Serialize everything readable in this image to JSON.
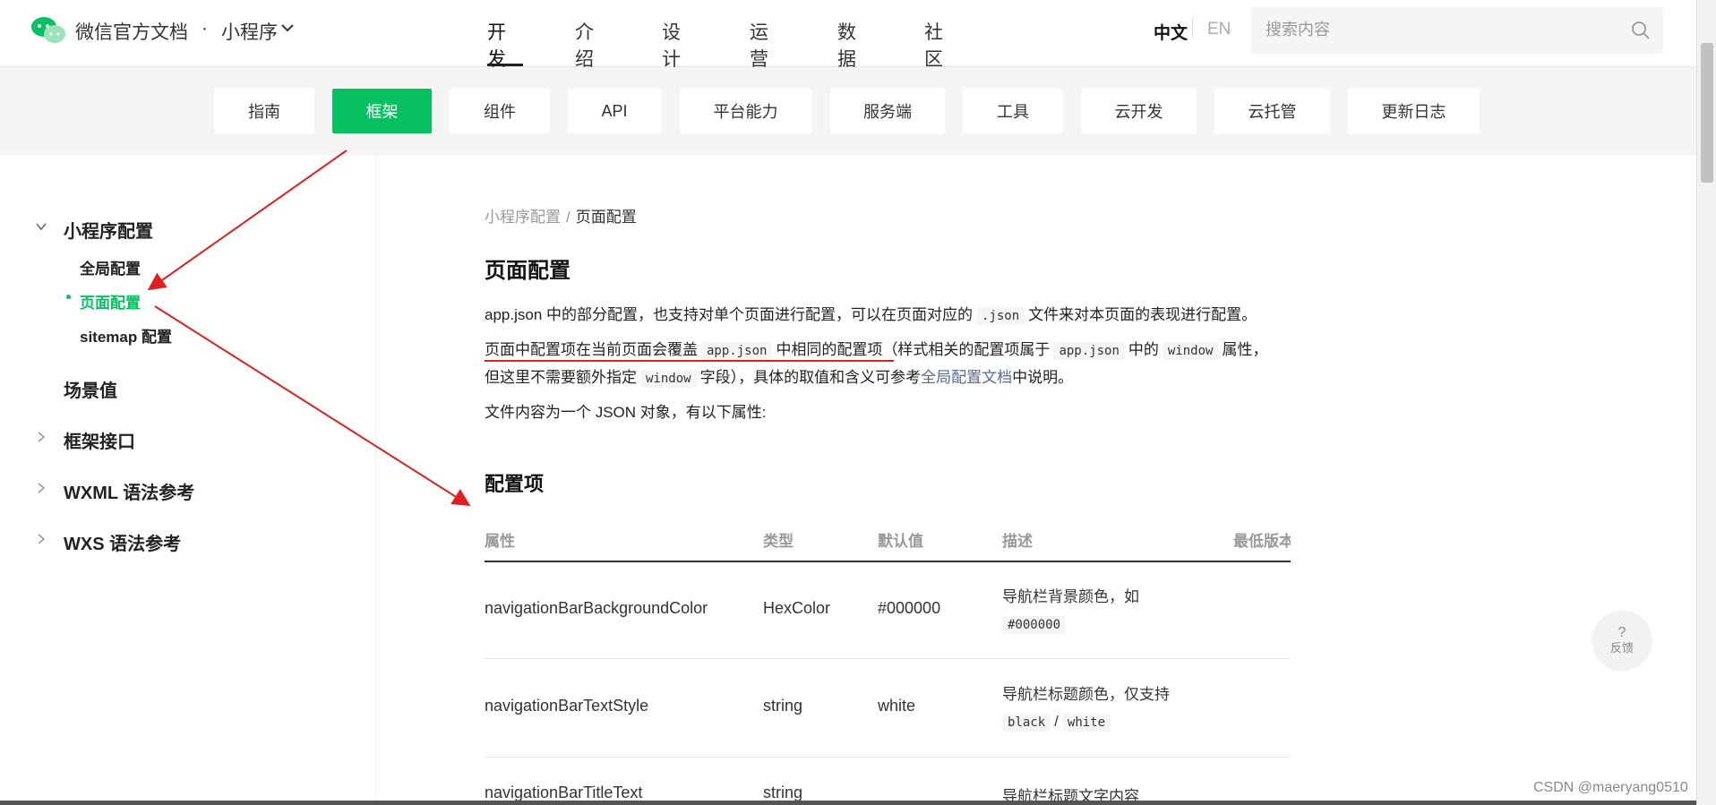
{
  "header": {
    "brand": "微信官方文档",
    "brand_separator": "·",
    "brand_sub": "小程序",
    "nav": [
      "开发",
      "介绍",
      "设计",
      "运营",
      "数据",
      "社区"
    ],
    "active_nav": "开发",
    "lang_zh": "中文",
    "lang_en": "EN",
    "search_placeholder": "搜索内容"
  },
  "subnav": {
    "items": [
      "指南",
      "框架",
      "组件",
      "API",
      "平台能力",
      "服务端",
      "工具",
      "云开发",
      "云托管",
      "更新日志"
    ],
    "active": "框架"
  },
  "sidebar": {
    "section": "小程序配置",
    "section_items": [
      "全局配置",
      "页面配置",
      "sitemap 配置"
    ],
    "active_item": "页面配置",
    "others": [
      "场景值",
      "框架接口",
      "WXML 语法参考",
      "WXS 语法参考"
    ]
  },
  "content": {
    "breadcrumb_parent": "小程序配置",
    "breadcrumb_sep": "/",
    "breadcrumb_current": "页面配置",
    "title": "页面配置",
    "p1_a": "app.json 中的部分配置，也支持对单个页面进行配置，可以在页面对应的",
    "p1_code": ".json",
    "p1_b": "文件来对本页面的表现进行配置。",
    "p2_a": "页面中配置项在当前页面会覆盖",
    "p2_code1": "app.json",
    "p2_b": "中相同的配置项",
    "p2_c": "（样式相关的配置项属于",
    "p2_code2": "app.json",
    "p2_d": "中的",
    "p2_code3": "window",
    "p2_e": "属性，",
    "p3_a": "但这里不需要额外指定",
    "p3_code": "window",
    "p3_b": "字段），具体的取值和含义可参考",
    "p3_link": "全局配置文档",
    "p3_c": "中说明。",
    "p4": "文件内容为一个 JSON 对象，有以下属性:",
    "section_title": "配置项"
  },
  "table": {
    "headers": [
      "属性",
      "类型",
      "默认值",
      "描述",
      "最低版本"
    ],
    "rows": [
      {
        "property": "navigationBarBackgroundColor",
        "type": "HexColor",
        "default": "#000000",
        "desc_text": "导航栏背景颜色，如",
        "desc_code": "#000000"
      },
      {
        "property": "navigationBarTextStyle",
        "type": "string",
        "default": "white",
        "desc_text": "导航栏标题颜色，仅支持",
        "desc_code1": "black",
        "desc_sep": "/",
        "desc_code2": "white"
      },
      {
        "property": "navigationBarTitleText",
        "type": "string",
        "default": "",
        "desc_text": "导航栏标题文字内容"
      }
    ]
  },
  "help": {
    "icon": "?",
    "label": "反馈"
  },
  "watermark": "CSDN @maeryang0510",
  "colors": {
    "accent": "#07c160",
    "link": "#576b95",
    "annotation": "#e02020"
  }
}
